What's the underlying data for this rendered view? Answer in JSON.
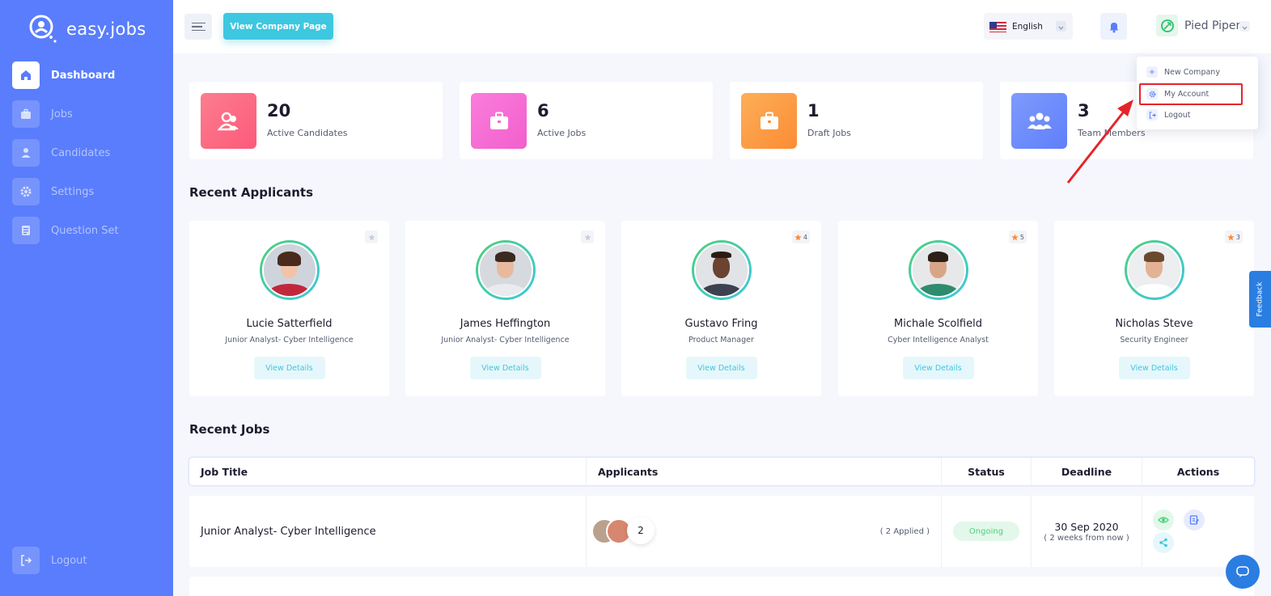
{
  "app": {
    "name": "easy.jobs"
  },
  "sidebar": {
    "items": [
      {
        "label": "Dashboard",
        "icon": "home-icon",
        "active": true
      },
      {
        "label": "Jobs",
        "icon": "briefcase-icon",
        "active": false
      },
      {
        "label": "Candidates",
        "icon": "user-icon",
        "active": false
      },
      {
        "label": "Settings",
        "icon": "gear-icon",
        "active": false
      },
      {
        "label": "Question Set",
        "icon": "document-icon",
        "active": false
      }
    ],
    "logout_label": "Logout"
  },
  "topbar": {
    "view_company_label": "View Company Page",
    "language": "English",
    "company_name": "Pied Piper"
  },
  "dropdown": {
    "items": [
      {
        "label": "New Company",
        "icon": "plus-icon"
      },
      {
        "label": "My Account",
        "icon": "gear-icon"
      },
      {
        "label": "Logout",
        "icon": "logout-icon"
      }
    ]
  },
  "stats": [
    {
      "value": "20",
      "label": "Active Candidates",
      "color": "#fc6e86"
    },
    {
      "value": "6",
      "label": "Active Jobs",
      "color": "#f56ad4"
    },
    {
      "value": "1",
      "label": "Draft Jobs",
      "color": "#fd9c45"
    },
    {
      "value": "3",
      "label": "Team Members",
      "color": "#6e8dfb"
    }
  ],
  "recent_applicants": {
    "title": "Recent Applicants",
    "view_label": "View Details",
    "items": [
      {
        "name": "Lucie Satterfield",
        "role": "Junior Analyst- Cyber Intelligence",
        "rating": ""
      },
      {
        "name": "James Heffington",
        "role": "Junior Analyst- Cyber Intelligence",
        "rating": ""
      },
      {
        "name": "Gustavo Fring",
        "role": "Product Manager",
        "rating": "4"
      },
      {
        "name": "Michale Scolfield",
        "role": "Cyber Intelligence Analyst",
        "rating": "5"
      },
      {
        "name": "Nicholas Steve",
        "role": "Security Engineer",
        "rating": "3"
      }
    ]
  },
  "recent_jobs": {
    "title": "Recent Jobs",
    "columns": [
      "Job Title",
      "Applicants",
      "Status",
      "Deadline",
      "Actions"
    ],
    "rows": [
      {
        "title": "Junior Analyst- Cyber Intelligence",
        "applicant_count": "2",
        "applied": "( 2 Applied )",
        "status": "Ongoing",
        "deadline": "30 Sep 2020",
        "deadline_relative": "( 2 weeks from now )"
      }
    ]
  },
  "feedback_label": "Feedback",
  "colors": {
    "sidebar": "#597dfc",
    "accent": "#3ec7e0",
    "success": "#4dd07a",
    "highlight": "#e5242a"
  }
}
